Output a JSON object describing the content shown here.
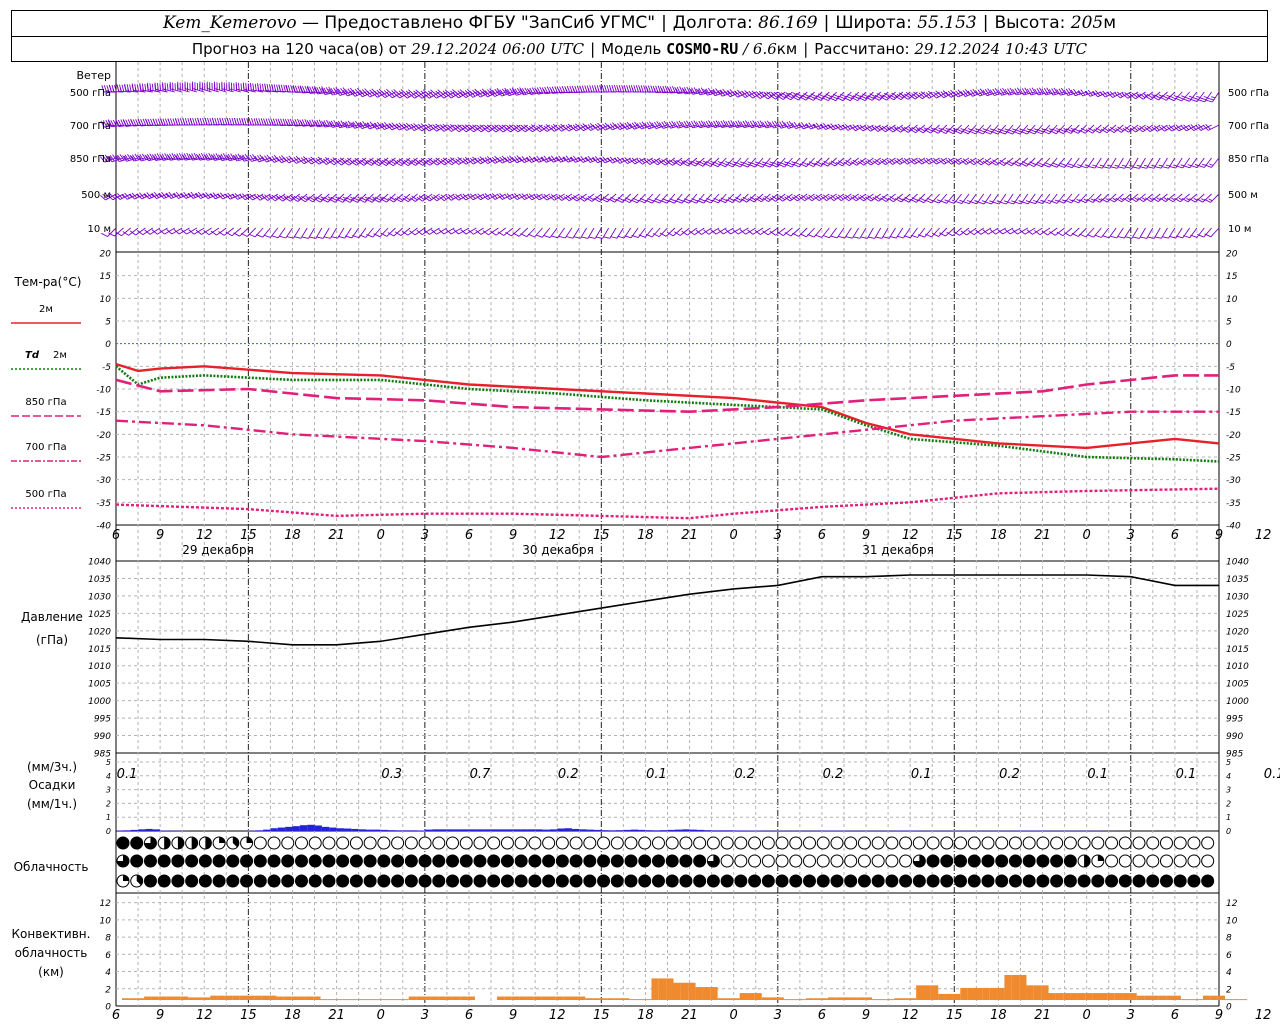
{
  "header": {
    "station": "Kem_Kemerovo",
    "dash": "—",
    "provider": "Предоставлено ФГБУ \"ЗапСиб УГМС\"",
    "lon_label": "Долгота:",
    "lon_value": "86.169",
    "lat_label": "Широта:",
    "lat_value": "55.153",
    "alt_label": "Высота:",
    "alt_value": "205",
    "alt_unit": "м",
    "forecast_label": "Прогноз на 120 часа(ов) от",
    "forecast_time": "29.12.2024 06:00 UTC",
    "model_label": "Модель",
    "model_name": "COSMO-RU",
    "model_res": "/ 6.6",
    "model_res_unit": "км",
    "calc_label": "Рассчитано:",
    "calc_time": "29.12.2024 10:43 UTC"
  },
  "chart_data": [
    {
      "type": "wind_barbs",
      "title": "Ветер",
      "levels": [
        "500 гПа",
        "700 гПа",
        "850 гПа",
        "500 м",
        "10 м"
      ],
      "color": "#7a00cc"
    },
    {
      "type": "line",
      "title": "Тем-ра(°C)",
      "ylim": [
        -40,
        20
      ],
      "yticks": [
        20,
        15,
        10,
        5,
        0,
        -5,
        -10,
        -15,
        -20,
        -25,
        -30,
        -35,
        -40
      ],
      "series": [
        {
          "name": "2м",
          "color": "#e8202a",
          "style": "solid",
          "points": [
            [
              0,
              -4.5
            ],
            [
              3,
              -6
            ],
            [
              6,
              -5.5
            ],
            [
              12,
              -5
            ],
            [
              24,
              -6.5
            ],
            [
              36,
              -7
            ],
            [
              48,
              -9
            ],
            [
              60,
              -10
            ],
            [
              72,
              -11
            ],
            [
              84,
              -12
            ],
            [
              96,
              -14
            ],
            [
              102,
              -17.5
            ],
            [
              108,
              -20
            ],
            [
              120,
              -22
            ],
            [
              132,
              -23
            ],
            [
              144,
              -21
            ],
            [
              150,
              -22
            ]
          ]
        },
        {
          "name": "2м",
          "prefix": "Td",
          "color": "#127a12",
          "style": "dotted",
          "points": [
            [
              0,
              -5
            ],
            [
              3,
              -9
            ],
            [
              6,
              -7.5
            ],
            [
              12,
              -7
            ],
            [
              24,
              -8
            ],
            [
              36,
              -8
            ],
            [
              48,
              -10
            ],
            [
              60,
              -11
            ],
            [
              72,
              -12.5
            ],
            [
              84,
              -13.5
            ],
            [
              90,
              -14
            ],
            [
              96,
              -14.5
            ],
            [
              102,
              -18
            ],
            [
              108,
              -21
            ],
            [
              120,
              -22.5
            ],
            [
              132,
              -25
            ],
            [
              144,
              -25.5
            ],
            [
              150,
              -26
            ]
          ]
        },
        {
          "name": "850 гПа",
          "color": "#e0207a",
          "style": "longdash",
          "points": [
            [
              0,
              -8
            ],
            [
              6,
              -10.5
            ],
            [
              18,
              -10
            ],
            [
              30,
              -12
            ],
            [
              42,
              -12.5
            ],
            [
              54,
              -14
            ],
            [
              66,
              -14.5
            ],
            [
              78,
              -15
            ],
            [
              90,
              -14
            ],
            [
              102,
              -12.5
            ],
            [
              114,
              -11.5
            ],
            [
              126,
              -10.5
            ],
            [
              132,
              -9
            ],
            [
              144,
              -7
            ],
            [
              150,
              -7
            ]
          ]
        },
        {
          "name": "700 гПа",
          "color": "#e0207a",
          "style": "dashdot",
          "points": [
            [
              0,
              -17
            ],
            [
              12,
              -18
            ],
            [
              24,
              -20
            ],
            [
              42,
              -21.5
            ],
            [
              54,
              -23
            ],
            [
              66,
              -25
            ],
            [
              78,
              -23
            ],
            [
              90,
              -21
            ],
            [
              102,
              -19
            ],
            [
              114,
              -17
            ],
            [
              126,
              -16
            ],
            [
              138,
              -15
            ],
            [
              150,
              -15
            ]
          ]
        },
        {
          "name": "500 гПа",
          "color": "#e0207a",
          "style": "finedot",
          "points": [
            [
              0,
              -35.5
            ],
            [
              18,
              -36.5
            ],
            [
              30,
              -38
            ],
            [
              42,
              -37.5
            ],
            [
              54,
              -37.5
            ],
            [
              66,
              -38
            ],
            [
              78,
              -38.5
            ],
            [
              84,
              -37.5
            ],
            [
              96,
              -36
            ],
            [
              108,
              -35
            ],
            [
              120,
              -33
            ],
            [
              132,
              -32.5
            ],
            [
              150,
              -32
            ]
          ]
        }
      ]
    },
    {
      "type": "line",
      "title": "Давление",
      "unit": "(гПа)",
      "ylim": [
        985,
        1040
      ],
      "yticks": [
        1040,
        1035,
        1030,
        1025,
        1020,
        1015,
        1010,
        1005,
        1000,
        995,
        990,
        985
      ],
      "series": [
        {
          "color": "#000000",
          "points": [
            [
              0,
              1018
            ],
            [
              6,
              1017.5
            ],
            [
              12,
              1017.5
            ],
            [
              18,
              1017
            ],
            [
              24,
              1016
            ],
            [
              30,
              1016
            ],
            [
              36,
              1017
            ],
            [
              42,
              1019
            ],
            [
              48,
              1021
            ],
            [
              54,
              1022.5
            ],
            [
              60,
              1024.5
            ],
            [
              66,
              1026.5
            ],
            [
              72,
              1028.5
            ],
            [
              78,
              1030.5
            ],
            [
              84,
              1032
            ],
            [
              90,
              1033
            ],
            [
              96,
              1035.5
            ],
            [
              102,
              1035.5
            ],
            [
              108,
              1036
            ],
            [
              114,
              1036
            ],
            [
              120,
              1036
            ],
            [
              126,
              1036
            ],
            [
              132,
              1036
            ],
            [
              138,
              1035.5
            ],
            [
              144,
              1033
            ],
            [
              150,
              1033
            ]
          ]
        }
      ]
    },
    {
      "type": "bar",
      "title": "Осадки",
      "unit_top": "(мм/3ч.)",
      "unit_bottom": "(мм/1ч.)",
      "ylim": [
        0,
        5
      ],
      "yticks": [
        5,
        4,
        3,
        2,
        1,
        0
      ],
      "color": "#2424d6",
      "labels_3h": [
        {
          "hour": 1.5,
          "value": "0.1"
        },
        {
          "hour": 19.5,
          "value": "0.3"
        },
        {
          "hour": 25.5,
          "value": "0.7"
        },
        {
          "hour": 31.5,
          "value": "0.2"
        },
        {
          "hour": 37.5,
          "value": "0.1"
        },
        {
          "hour": 43.5,
          "value": "0.2"
        },
        {
          "hour": 49.5,
          "value": "0.2"
        },
        {
          "hour": 55.5,
          "value": "0.1"
        },
        {
          "hour": 61.5,
          "value": "0.2"
        },
        {
          "hour": 67.5,
          "value": "0.1"
        },
        {
          "hour": 73.5,
          "value": "0.1"
        },
        {
          "hour": 79.5,
          "value": "0.1"
        },
        {
          "hour": 85.5,
          "value": "0.1"
        },
        {
          "hour": 91.5,
          "value": "0.1"
        },
        {
          "hour": 97.5,
          "value": "0.1"
        }
      ],
      "bars_1h": [
        0.03,
        0.05,
        0.08,
        0.12,
        0.15,
        0.12,
        0.03,
        0.02,
        0.02,
        0.01,
        0,
        0,
        0,
        0,
        0,
        0,
        0,
        0,
        0.02,
        0.05,
        0.1,
        0.2,
        0.25,
        0.3,
        0.35,
        0.42,
        0.45,
        0.4,
        0.3,
        0.25,
        0.2,
        0.18,
        0.15,
        0.12,
        0.1,
        0.1,
        0.08,
        0.06,
        0.05,
        0.05,
        0.05,
        0.04,
        0.1,
        0.12,
        0.12,
        0.12,
        0.12,
        0.12,
        0.12,
        0.12,
        0.12,
        0.12,
        0.12,
        0.12,
        0.12,
        0.12,
        0.12,
        0.12,
        0.1,
        0.12,
        0.18,
        0.2,
        0.15,
        0.12,
        0.1,
        0.08,
        0.06,
        0.05,
        0.06,
        0.08,
        0.1,
        0.08,
        0.06,
        0.05,
        0.06,
        0.08,
        0.1,
        0.12,
        0.1,
        0.08,
        0.06,
        0.05,
        0.05,
        0.05,
        0.04,
        0.04,
        0.03,
        0.03,
        0.02,
        0.02,
        0.02,
        0.02,
        0.02,
        0.02,
        0.02,
        0.02,
        0.03,
        0.03,
        0.03,
        0.02,
        0.02,
        0.02,
        0.02,
        0.02,
        0.02,
        0.02,
        0.03,
        0.03,
        0.03,
        0.02,
        0.02,
        0.02,
        0.02,
        0.02,
        0.02,
        0.02,
        0.02,
        0.02,
        0.02,
        0.02,
        0.02,
        0.02,
        0.02,
        0.03,
        0.03,
        0.03,
        0.02,
        0.02,
        0.02,
        0.02,
        0.02,
        0.02,
        0.02,
        0.02,
        0.01,
        0.01,
        0,
        0,
        0,
        0,
        0,
        0,
        0,
        0,
        0,
        0,
        0,
        0,
        0,
        0,
        0
      ]
    },
    {
      "type": "cloud_cover",
      "title": "Облачность",
      "rows_oktas": [
        [
          8,
          8,
          6,
          4,
          4,
          4,
          4,
          2,
          3,
          2,
          0,
          0,
          0,
          0,
          0,
          0,
          0,
          0,
          0,
          0,
          0,
          0,
          0,
          0,
          0,
          0,
          0,
          0,
          0,
          0,
          0,
          0,
          0,
          0,
          0,
          0,
          0,
          0,
          0,
          0,
          0,
          0,
          0,
          0,
          0,
          0,
          0,
          0,
          0,
          0,
          0,
          0,
          0,
          0,
          0,
          0,
          0,
          0,
          0,
          0,
          0,
          0,
          0,
          0,
          0,
          0,
          0,
          0,
          0,
          0,
          0,
          0,
          0,
          0,
          0,
          0,
          0,
          0,
          0,
          0,
          0,
          0,
          0,
          0,
          0,
          0,
          0,
          0,
          0,
          0,
          0,
          0,
          0,
          0,
          0,
          0,
          0,
          0,
          0,
          0,
          0
        ],
        [
          6,
          8,
          8,
          8,
          8,
          8,
          8,
          8,
          8,
          8,
          8,
          8,
          8,
          8,
          8,
          8,
          8,
          8,
          8,
          8,
          8,
          8,
          8,
          8,
          8,
          8,
          8,
          8,
          8,
          8,
          8,
          8,
          8,
          8,
          8,
          8,
          8,
          8,
          8,
          8,
          8,
          8,
          8,
          6,
          0,
          0,
          0,
          0,
          0,
          0,
          0,
          0,
          0,
          0,
          0,
          0,
          0,
          0,
          6,
          8,
          8,
          8,
          8,
          8,
          8,
          8,
          8,
          8,
          8,
          8,
          4,
          2,
          0,
          0,
          0,
          0,
          0,
          0,
          0,
          0,
          0,
          0,
          0,
          0,
          0,
          0,
          0,
          0,
          0,
          0,
          0,
          0,
          0,
          0,
          0,
          0,
          0,
          0,
          0,
          0,
          0
        ],
        [
          2,
          3,
          8,
          8,
          8,
          8,
          8,
          8,
          8,
          8,
          8,
          8,
          8,
          8,
          8,
          8,
          8,
          8,
          8,
          8,
          8,
          8,
          8,
          8,
          8,
          8,
          8,
          8,
          8,
          8,
          8,
          8,
          8,
          8,
          8,
          8,
          8,
          8,
          8,
          8,
          8,
          8,
          8,
          8,
          8,
          8,
          8,
          8,
          8,
          8,
          8,
          8,
          8,
          8,
          8,
          8,
          8,
          8,
          8,
          8,
          8,
          8,
          8,
          8,
          8,
          8,
          8,
          8,
          8,
          8,
          8,
          8,
          8,
          8,
          8,
          8,
          8,
          8,
          8,
          8,
          8,
          8,
          8,
          8,
          8,
          8,
          8,
          8,
          8,
          8,
          8,
          8,
          3,
          0,
          0,
          0,
          0,
          0,
          0,
          0,
          0
        ]
      ]
    },
    {
      "type": "bar",
      "title_lines": [
        "Конвективн.",
        "облачность",
        "(км)"
      ],
      "ylim": [
        0,
        13
      ],
      "yticks": [
        12,
        10,
        8,
        6,
        4,
        2,
        0
      ],
      "color": "#ef8a2e",
      "bars_1h": [
        0.9,
        0.9,
        0.9,
        1.1,
        1.1,
        1.1,
        1.1,
        1.1,
        1.1,
        1.0,
        1.0,
        1.0,
        1.2,
        1.2,
        1.2,
        1.2,
        1.2,
        1.2,
        1.2,
        1.2,
        1.2,
        1.1,
        1.1,
        1.1,
        1.1,
        1.1,
        1.1,
        0.8,
        0.8,
        0.8,
        0.8,
        0.8,
        0.8,
        0.8,
        0.8,
        0.8,
        0.8,
        0.8,
        0.8,
        1.1,
        1.1,
        1.1,
        1.1,
        1.1,
        1.1,
        1.1,
        1.1,
        1.1,
        0,
        0,
        0,
        1.1,
        1.1,
        1.1,
        1.1,
        1.1,
        1.1,
        1.1,
        1.1,
        1.1,
        1.1,
        1.1,
        1.1,
        0.9,
        0.9,
        0.9,
        0.9,
        0.9,
        0.9,
        0.8,
        0.8,
        0.8,
        3.2,
        3.2,
        3.2,
        2.7,
        2.7,
        2.7,
        2.2,
        2.2,
        2.2,
        0.9,
        0.9,
        0.9,
        1.5,
        1.5,
        1.5,
        1.0,
        1.0,
        1.0,
        0.8,
        0.8,
        0.8,
        0.9,
        0.9,
        0.9,
        1.0,
        1.0,
        1.0,
        1.0,
        1.0,
        1.0,
        0.8,
        0.8,
        0.8,
        0.9,
        0.9,
        0.9,
        2.4,
        2.4,
        2.4,
        1.4,
        1.4,
        1.4,
        2.1,
        2.1,
        2.1,
        2.1,
        2.1,
        2.1,
        3.6,
        3.6,
        3.6,
        2.4,
        2.4,
        2.4,
        1.5,
        1.5,
        1.5,
        1.5,
        1.5,
        1.5,
        1.5,
        1.5,
        1.5,
        1.5,
        1.5,
        1.5,
        1.2,
        1.2,
        1.2,
        1.2,
        1.2,
        1.2,
        0.8,
        0.8,
        0.8,
        1.2,
        1.2,
        1.2,
        0.8,
        0.8,
        0.8
      ]
    }
  ],
  "time_axis": {
    "hour_labels": [
      "6",
      "9",
      "12",
      "15",
      "18",
      "21",
      "0",
      "3",
      "6",
      "9",
      "12",
      "15",
      "18",
      "21",
      "0",
      "3",
      "6",
      "9",
      "12",
      "15",
      "18",
      "21",
      "0",
      "3",
      "6",
      "9",
      "12"
    ],
    "day_labels": [
      {
        "hour": 9,
        "text": "29 декабря"
      },
      {
        "hour": 33,
        "text": "30 декабря"
      },
      {
        "hour": 57,
        "text": "31 декабря"
      }
    ]
  },
  "style": {
    "wind_color": "#7a00cc",
    "grid_color": "#b4b4b4",
    "zero_line_color": "#3060ff"
  }
}
